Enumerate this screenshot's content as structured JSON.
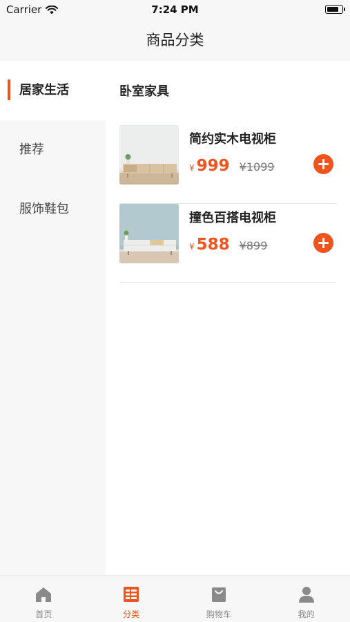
{
  "status": {
    "carrier": "Carrier",
    "time": "7:24 PM",
    "battery_level": 0.7
  },
  "nav": {
    "title": "商品分类"
  },
  "sidebar": {
    "items": [
      {
        "label": "居家生活",
        "active": true
      },
      {
        "label": "推荐",
        "active": false
      },
      {
        "label": "服饰鞋包",
        "active": false
      }
    ]
  },
  "content": {
    "section_title": "卧室家具",
    "products": [
      {
        "name": "简约实木电视柜",
        "currency": "¥",
        "price": "999",
        "old_price": "¥1099",
        "add_icon": "plus-circle-icon"
      },
      {
        "name": "撞色百搭电视柜",
        "currency": "¥",
        "price": "588",
        "old_price": "¥899",
        "add_icon": "plus-circle-icon"
      }
    ]
  },
  "tabbar": {
    "tabs": [
      {
        "label": "首页",
        "icon": "home-icon",
        "active": false
      },
      {
        "label": "分类",
        "icon": "category-icon",
        "active": true
      },
      {
        "label": "购物车",
        "icon": "cart-icon",
        "active": false
      },
      {
        "label": "我的",
        "icon": "profile-icon",
        "active": false
      }
    ]
  },
  "colors": {
    "accent": "#f0541e",
    "background": "#f7f7f7",
    "inactive_tab": "#888888"
  }
}
